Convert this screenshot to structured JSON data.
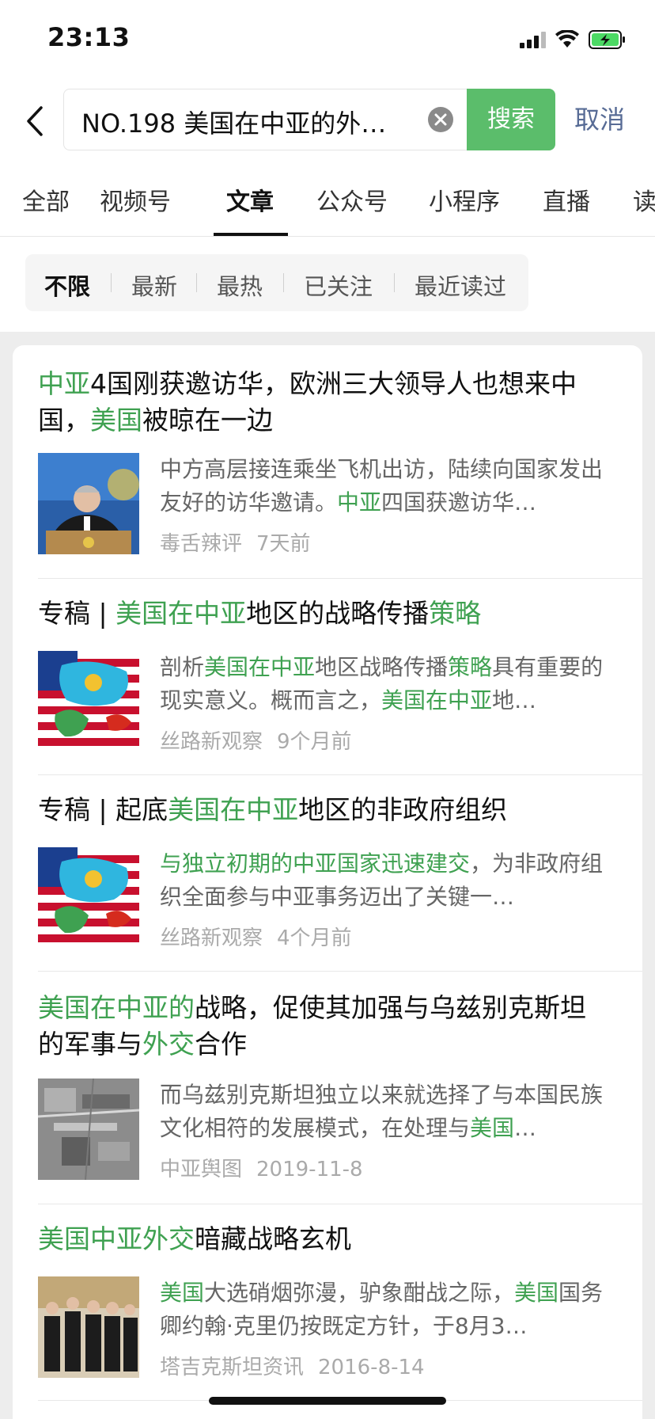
{
  "status": {
    "time": "23:13"
  },
  "search": {
    "query": "NO.198 美国在中亚的外…",
    "button": "搜索",
    "cancel": "取消"
  },
  "tabs": [
    "全部",
    "视频号",
    "文章",
    "公众号",
    "小程序",
    "直播",
    "读"
  ],
  "active_tab": "文章",
  "filters": [
    "不限",
    "最新",
    "最热",
    "已关注",
    "最近读过"
  ],
  "active_filter": "不限",
  "accent_color": "#3fa151",
  "results": [
    {
      "title": [
        [
          "中亚",
          true
        ],
        [
          "4国刚获邀访华，欧洲三大领导人也想来中国，",
          false
        ],
        [
          "美国",
          true
        ],
        [
          "被晾在一边",
          false
        ]
      ],
      "snippet": [
        [
          "中方高层接连乘坐飞机出访，陆续向国家发出友好的访华邀请。",
          false
        ],
        [
          "中亚",
          true
        ],
        [
          "四国获邀访华…",
          false
        ]
      ],
      "source": "毒舌辣评",
      "time": "7天前",
      "thumb": "president-speech-photo"
    },
    {
      "title": [
        [
          "专稿 | ",
          false
        ],
        [
          "美国在中亚",
          true
        ],
        [
          "地区的战略传播",
          false
        ],
        [
          "策略",
          true
        ]
      ],
      "snippet": [
        [
          "剖析",
          false
        ],
        [
          "美国在中亚",
          true
        ],
        [
          "地区战略传播",
          false
        ],
        [
          "策略",
          true
        ],
        [
          "具有重要的现实意义。概而言之，",
          false
        ],
        [
          "美国在中亚",
          true
        ],
        [
          "地…",
          false
        ]
      ],
      "source": "丝路新观察",
      "time": "9个月前",
      "thumb": "us-central-asia-flags-map"
    },
    {
      "title": [
        [
          "专稿 | 起底",
          false
        ],
        [
          "美国在中亚",
          true
        ],
        [
          "地区的非政府组织",
          false
        ]
      ],
      "snippet": [
        [
          "与独立初期的中亚国家迅速建交",
          true
        ],
        [
          "，为非政府组织全面参与中亚事务迈出了关键一…",
          false
        ]
      ],
      "source": "丝路新观察",
      "time": "4个月前",
      "thumb": "us-central-asia-flags-map"
    },
    {
      "title": [
        [
          "美国在中亚的",
          true
        ],
        [
          "战略，促使其加强与乌兹别克斯坦的军事与",
          false
        ],
        [
          "外交",
          true
        ],
        [
          "合作",
          false
        ]
      ],
      "snippet": [
        [
          "而乌兹别克斯坦独立以来就选择了与本国民族文化相符的发展模式，在处理与",
          false
        ],
        [
          "美国",
          true
        ],
        [
          "…",
          false
        ]
      ],
      "source": "中亚舆图",
      "time": "2019-11-8",
      "thumb": "satellite-base-photo"
    },
    {
      "title": [
        [
          "美国中亚外交",
          true
        ],
        [
          "暗藏战略玄机",
          false
        ]
      ],
      "snippet": [
        [
          "美国",
          true
        ],
        [
          "大选硝烟弥漫，驴象酣战之际，",
          false
        ],
        [
          "美国",
          true
        ],
        [
          "国务卿约翰·克里仍按既定方针，于8月3…",
          false
        ]
      ],
      "source": "塔吉克斯坦资讯",
      "time": "2016-8-14",
      "thumb": "diplomats-group-photo"
    }
  ]
}
